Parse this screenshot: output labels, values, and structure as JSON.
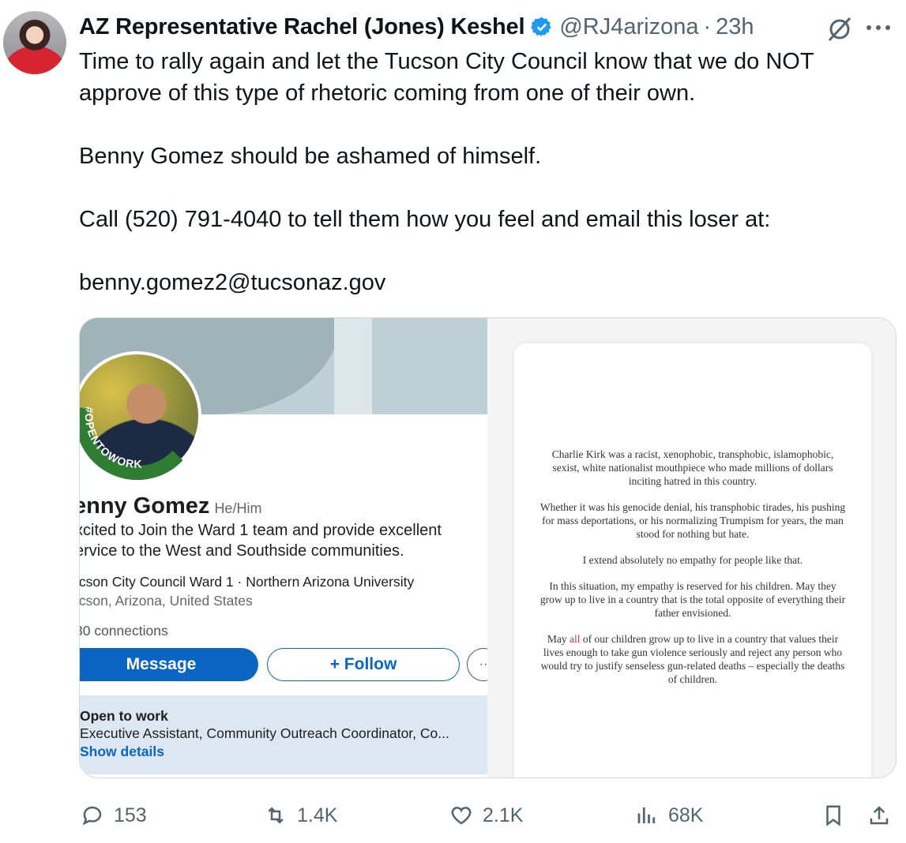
{
  "tweet": {
    "author_name": "AZ Representative Rachel (Jones) Keshel",
    "handle": "@RJ4arizona",
    "separator": "·",
    "time": "23h",
    "text": "Time to rally again and let the Tucson City Council know that we do NOT approve of this type of rhetoric coming from one of their own.\n\nBenny Gomez should be ashamed of himself.\n\nCall (520) 791-4040 to tell them how you feel and email this loser at:\n\nbenny.gomez2@tucsonaz.gov",
    "icons": {
      "verified": "verified-badge-icon",
      "grok": "grok-icon",
      "more": "more-icon"
    }
  },
  "media": {
    "linkedin": {
      "badge_text": "#OPENTOWORK",
      "name": "enny Gomez",
      "pronouns": "He/Him",
      "headline": "xcited to Join the Ward 1 team and provide excellent ervice to the West and Southside communities.",
      "org": "ıcson City Council Ward 1 · Northern Arizona University",
      "location": "ıcson, Arizona, United States",
      "connections": "30 connections",
      "message_button": "Message",
      "follow_button": "+ Follow",
      "more_button": "··",
      "open_to_work_title": "Open to work",
      "open_to_work_roles": "Executive Assistant, Community Outreach Coordinator, Co...",
      "show_details": "Show details"
    },
    "statement": {
      "p1": "Charlie Kirk was a racist, xenophobic, transphobic, islamophobic, sexist, white nationalist mouthpiece who made millions of dollars inciting hatred in this country.",
      "p2": "Whether it was his genocide denial, his transphobic tirades, his pushing for mass deportations, or his normalizing Trumpism for years, the man stood for nothing but hate.",
      "p3": "I extend absolutely no empathy for people like that.",
      "p4": "In this situation, my empathy is reserved for his children. May they grow up to live in a country that is the total opposite of everything their father envisioned.",
      "p5_before": "May ",
      "p5_highlight": "all",
      "p5_after": " of our children grow up to live in a country that values their lives enough to take gun violence seriously and reject any person who would try to justify senseless gun-related deaths – especially the deaths of children."
    }
  },
  "actions": {
    "replies": "153",
    "reposts": "1.4K",
    "likes": "2.1K",
    "views": "68K",
    "icons": [
      "reply-icon",
      "repost-icon",
      "like-icon",
      "views-icon",
      "bookmark-icon",
      "share-icon"
    ]
  },
  "colors": {
    "link_blue": "#0a66c2",
    "verified_blue": "#1d9bf0",
    "muted": "#536471"
  }
}
